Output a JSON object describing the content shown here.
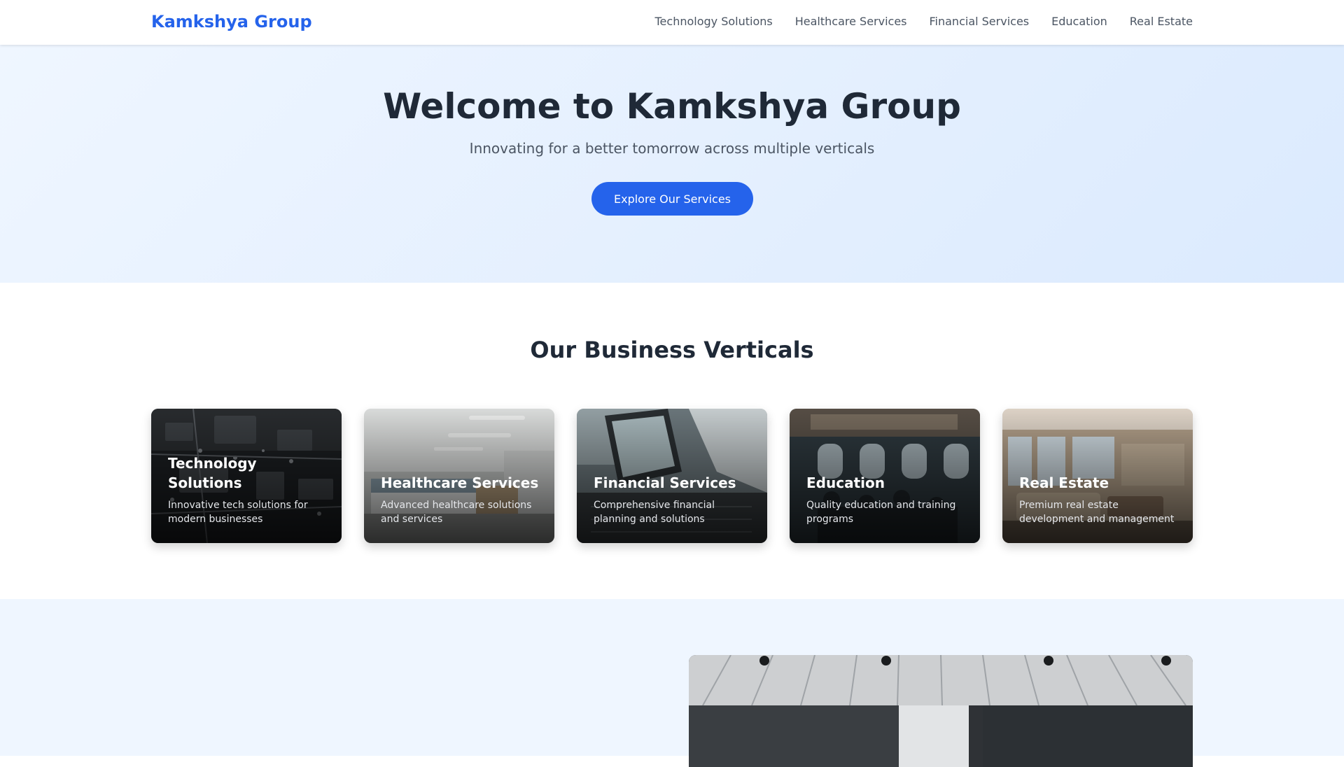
{
  "header": {
    "brand": "Kamkshya Group",
    "nav": [
      {
        "label": "Technology Solutions"
      },
      {
        "label": "Healthcare Services"
      },
      {
        "label": "Financial Services"
      },
      {
        "label": "Education"
      },
      {
        "label": "Real Estate"
      }
    ]
  },
  "hero": {
    "title": "Welcome to Kamkshya Group",
    "subtitle": "Innovating for a better tomorrow across multiple verticals",
    "cta_label": "Explore Our Services"
  },
  "verticals": {
    "title": "Our Business Verticals",
    "cards": [
      {
        "title": "Technology Solutions",
        "description": "Innovative tech solutions for modern businesses",
        "image": "circuit-board-photo"
      },
      {
        "title": "Healthcare Services",
        "description": "Advanced healthcare solutions and services",
        "image": "hospital-ward-photo"
      },
      {
        "title": "Financial Services",
        "description": "Comprehensive financial planning and solutions",
        "image": "laptop-finance-photo"
      },
      {
        "title": "Education",
        "description": "Quality education and training programs",
        "image": "classroom-photo"
      },
      {
        "title": "Real Estate",
        "description": "Premium real estate development and management",
        "image": "living-room-photo"
      }
    ]
  },
  "about": {
    "image": "modern-office-photo"
  },
  "colors": {
    "brand": "#2563eb",
    "text_dark": "#1f2937",
    "text_muted": "#4b5563",
    "hero_bg_start": "#eff6ff",
    "hero_bg_end": "#dbeafe"
  }
}
